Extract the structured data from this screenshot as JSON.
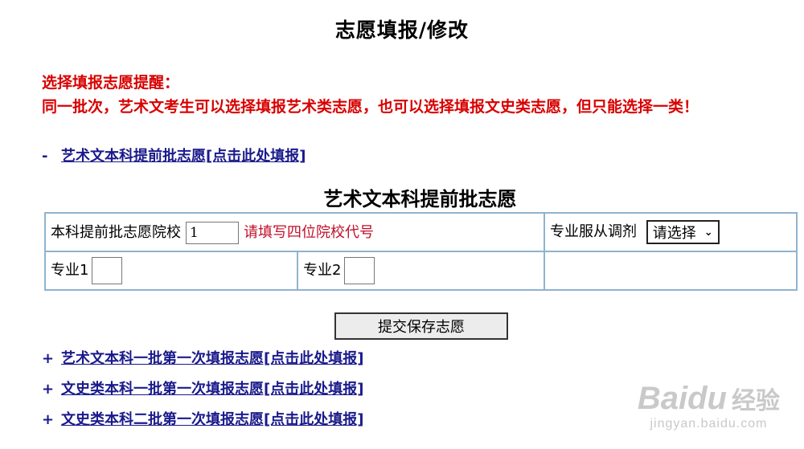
{
  "page": {
    "title": "志愿填报/修改"
  },
  "reminder": {
    "heading": "选择填报志愿提醒：",
    "text": "同一批次，艺术文考生可以选择填报艺术类志愿，也可以选择填报文史类志愿，但只能选择一类！"
  },
  "links": [
    {
      "bullet": "-",
      "text": "艺术文本科提前批志愿[点击此处填报]"
    },
    {
      "bullet": "+",
      "text": "艺术文本科一批第一次填报志愿[点击此处填报]"
    },
    {
      "bullet": "+",
      "text": "文史类本科一批第一次填报志愿[点击此处填报]"
    },
    {
      "bullet": "+",
      "text": "文史类本科二批第一次填报志愿[点击此处填报]"
    }
  ],
  "form": {
    "title": "艺术文本科提前批志愿",
    "school_label": "本科提前批志愿院校",
    "school_value": "1",
    "school_hint": "请填写四位院校代号",
    "adjust_label": "专业服从调剂",
    "adjust_value": "请选择",
    "major1_label": "专业1",
    "major2_label": "专业2",
    "submit_label": "提交保存志愿"
  },
  "watermark": {
    "brand": "Baidu",
    "brand_zh": "经验",
    "url": "jingyan.baidu.com"
  }
}
